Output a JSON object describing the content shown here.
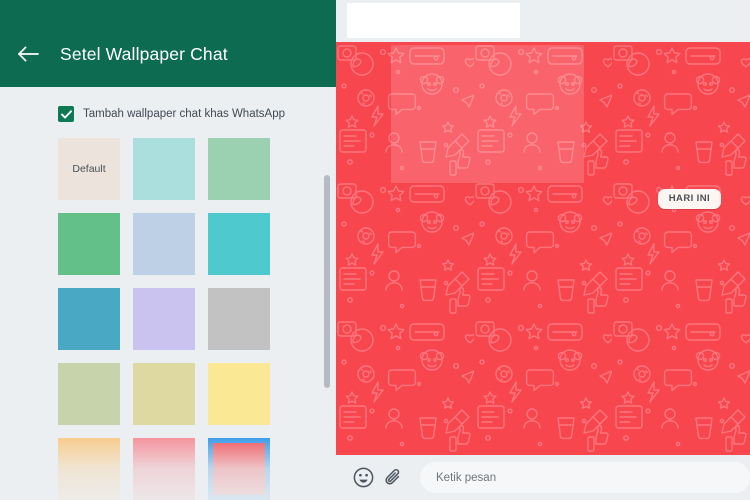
{
  "settings": {
    "header": {
      "title": "Setel Wallpaper Chat",
      "back_icon": "arrow-left-icon",
      "background_color": "#0d6b51"
    },
    "checkbox": {
      "label": "Tambah wallpaper chat khas WhatsApp",
      "checked": true,
      "check_color": "#0d7a54"
    },
    "default_swatch_label": "Default",
    "selection_color": "#1d8fe8",
    "swatches": [
      {
        "name": "default",
        "color": "#ece4dc",
        "label": "Default",
        "selected": false
      },
      {
        "name": "pale-cyan",
        "color": "#aadfdd",
        "label": "",
        "selected": false
      },
      {
        "name": "mint-green",
        "color": "#9bd1b0",
        "label": "",
        "selected": false
      },
      {
        "name": "jade-green",
        "color": "#64c089",
        "label": "",
        "selected": false
      },
      {
        "name": "powder-blue",
        "color": "#bed0e5",
        "label": "",
        "selected": false
      },
      {
        "name": "turquoise",
        "color": "#4ec9ce",
        "label": "",
        "selected": false
      },
      {
        "name": "steel-blue",
        "color": "#49a8c3",
        "label": "",
        "selected": false
      },
      {
        "name": "lavender",
        "color": "#cbc3ef",
        "label": "",
        "selected": false
      },
      {
        "name": "silver-grey",
        "color": "#c2c2c2",
        "label": "",
        "selected": false
      },
      {
        "name": "sage-green",
        "color": "#c6d3ab",
        "label": "",
        "selected": false
      },
      {
        "name": "khaki",
        "color": "#ded9a1",
        "label": "",
        "selected": false
      },
      {
        "name": "pale-yellow",
        "color": "#fbe894",
        "label": "",
        "selected": false
      },
      {
        "name": "apricot",
        "color": "#fbc67d",
        "label": "",
        "selected": false
      },
      {
        "name": "salmon-pink",
        "color": "#f7848e",
        "label": "",
        "selected": false
      },
      {
        "name": "coral-red",
        "color": "#f0454c",
        "label": "",
        "selected": true
      }
    ]
  },
  "preview": {
    "wallpaper_color": "#f8464f",
    "date_divider": "HARI INI",
    "input_bar": {
      "emoji_icon": "emoji-smiley-icon",
      "attach_icon": "paperclip-icon",
      "placeholder": "Ketik pesan"
    }
  }
}
